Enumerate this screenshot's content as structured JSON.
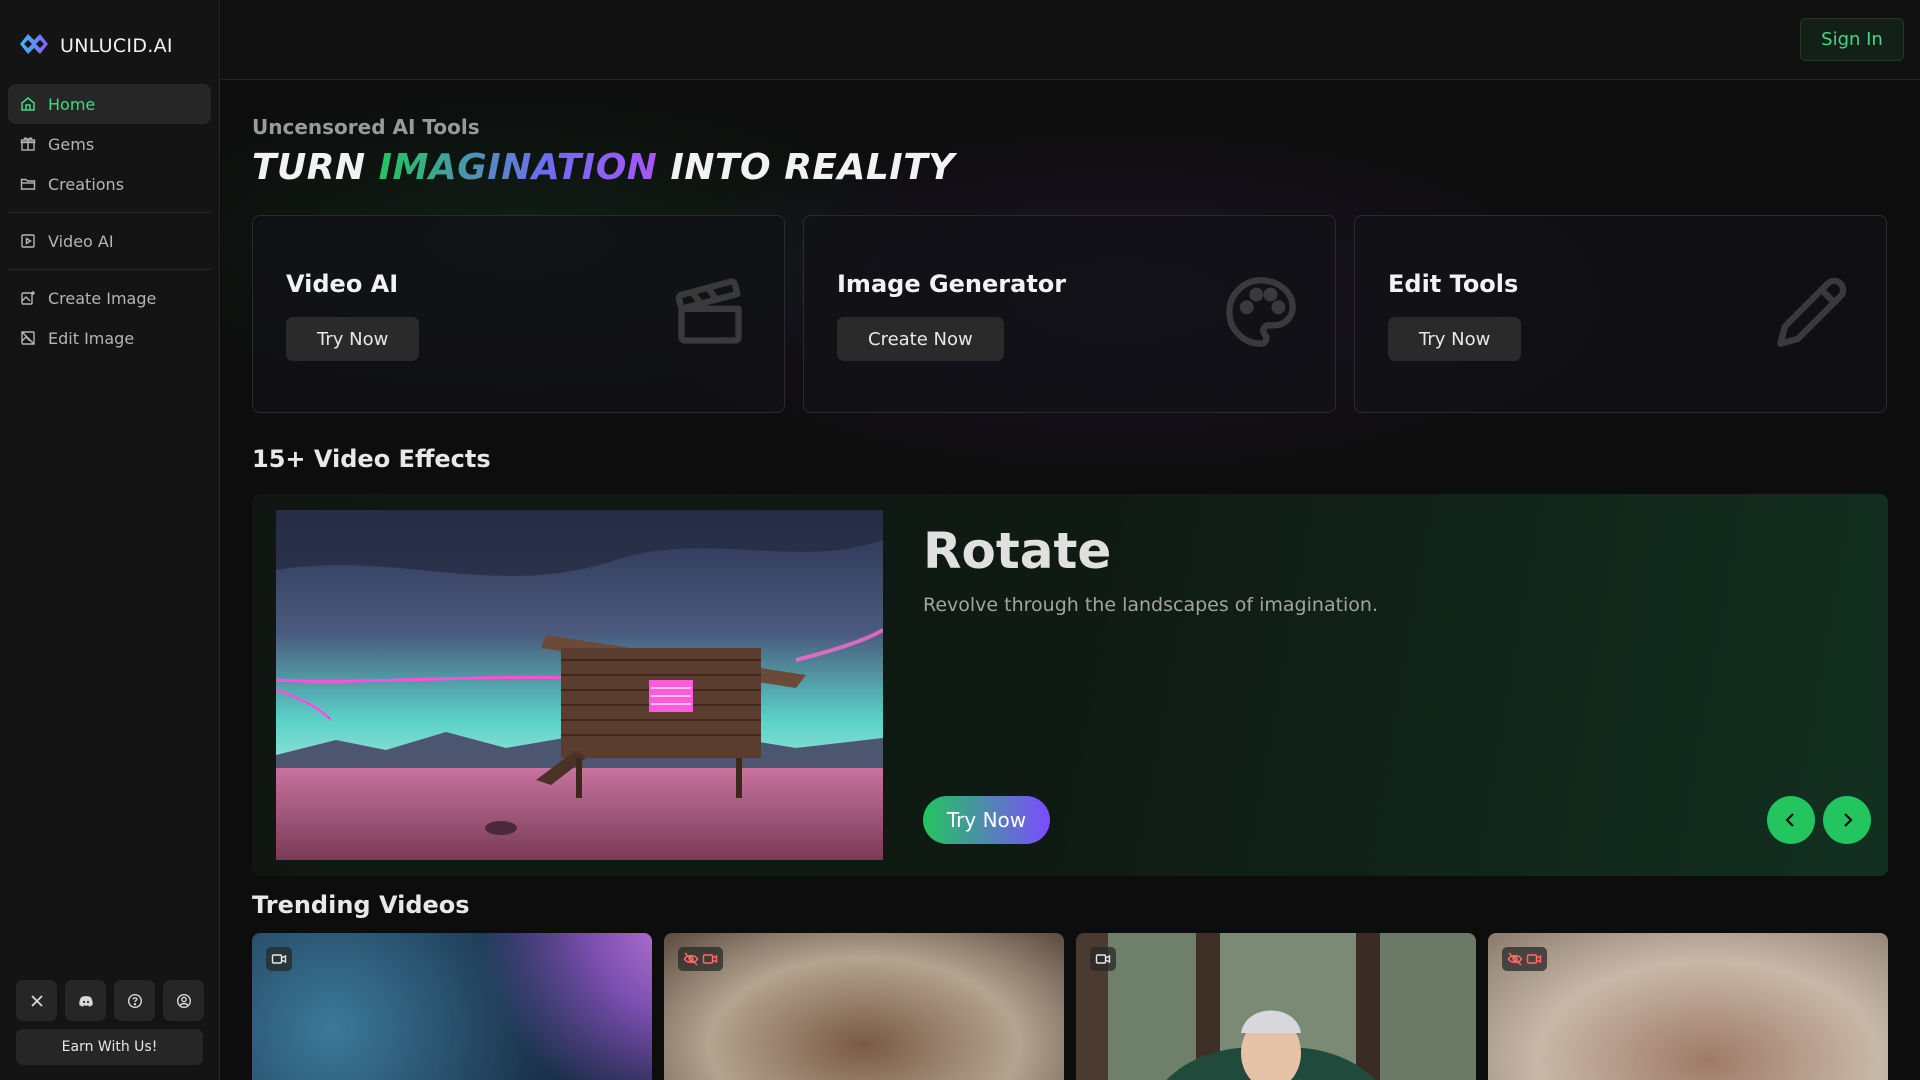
{
  "brand": {
    "name": "UNLUCID.AI"
  },
  "sidebar": {
    "nav_group1": [
      {
        "label": "Home",
        "icon": "home-icon",
        "active": true
      },
      {
        "label": "Gems",
        "icon": "gift-icon"
      },
      {
        "label": "Creations",
        "icon": "folder-icon"
      }
    ],
    "nav_group2": [
      {
        "label": "Video AI",
        "icon": "video-square-icon"
      }
    ],
    "nav_group3": [
      {
        "label": "Create Image",
        "icon": "image-plus-icon"
      },
      {
        "label": "Edit Image",
        "icon": "image-off-icon"
      }
    ],
    "social": [
      "x-icon",
      "discord-icon",
      "help-circle-icon",
      "user-circle-icon"
    ],
    "earn_label": "Earn With Us!"
  },
  "header": {
    "signin_label": "Sign In"
  },
  "hero": {
    "eyebrow": "Uncensored AI Tools",
    "headline_pre": "TURN ",
    "headline_accent": "IMAGINATION",
    "headline_post": " INTO REALITY"
  },
  "tools": [
    {
      "title": "Video AI",
      "button": "Try Now",
      "icon": "clapperboard-icon"
    },
    {
      "title": "Image Generator",
      "button": "Create Now",
      "icon": "palette-icon"
    },
    {
      "title": "Edit Tools",
      "button": "Try Now",
      "icon": "pencil-icon"
    }
  ],
  "effects": {
    "section_title": "15+ Video Effects",
    "current": {
      "title": "Rotate",
      "description": "Revolve through the landscapes of imagination.",
      "button": "Try Now"
    }
  },
  "trending": {
    "section_title": "Trending Videos",
    "videos": [
      {
        "badge": "video-icon",
        "nsfw": false
      },
      {
        "badge": "video-hidden-icon",
        "nsfw": true
      },
      {
        "badge": "video-icon",
        "nsfw": false
      },
      {
        "badge": "video-hidden-icon",
        "nsfw": true
      }
    ]
  },
  "colors": {
    "accent": "#22c55e",
    "accent_alt": "#a855f7",
    "bg": "#0d0d0d",
    "sidebar": "#141414"
  }
}
